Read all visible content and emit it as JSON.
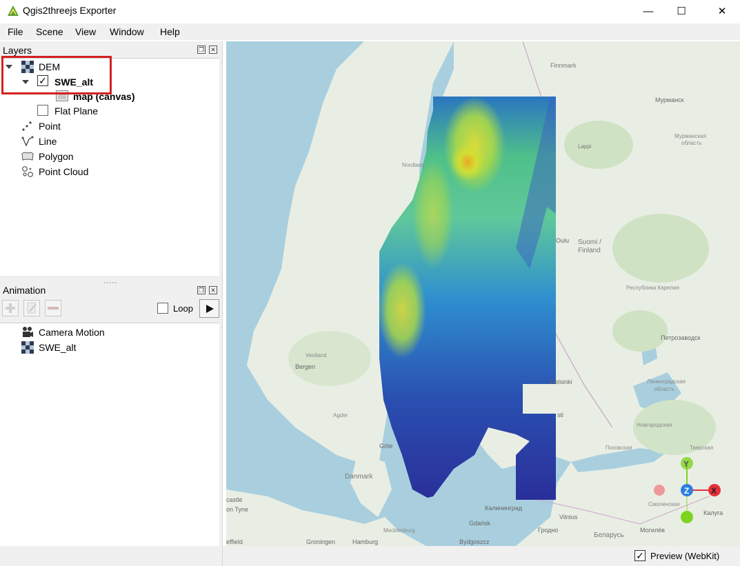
{
  "window": {
    "title": "Qgis2threejs Exporter",
    "minimize_glyph": "—",
    "maximize_glyph": "☐",
    "close_glyph": "✕"
  },
  "menu": [
    "File",
    "Scene",
    "View",
    "Window",
    "Help"
  ],
  "layers_panel": {
    "title": "Layers",
    "items": {
      "dem": "DEM",
      "swe_alt": "SWE_alt",
      "map_canvas": "map (canvas)",
      "flat_plane": "Flat Plane",
      "point": "Point",
      "line": "Line",
      "polygon": "Polygon",
      "point_cloud": "Point Cloud"
    }
  },
  "animation_panel": {
    "title": "Animation",
    "loop_label": "Loop",
    "items": [
      "Camera Motion",
      "SWE_alt"
    ]
  },
  "status": {
    "preview_label": "Preview (WebKit)",
    "preview_checked": true
  },
  "map_labels": {
    "finnmark": "Finnmark",
    "murmansk": "Мурманск",
    "murmansk_obl": "Мурманская",
    "oblast": "область",
    "lappi": "Lappi",
    "nordland": "Nordland",
    "oulu": "Oulu",
    "suomi": "Suomi /",
    "finland": "Finland",
    "karelia": "Республика Карелия",
    "petrozavodsk": "Петрозаводск",
    "leningrad": "Ленинградская",
    "novgorod": "Новгородская",
    "pskov": "Псковская",
    "tver": "Тверская",
    "smolensk": "Смоленская",
    "kaluga": "Калуга",
    "bergen": "Bergen",
    "vestland": "Vestland",
    "agder": "Agder",
    "helsinki": "Helsinki",
    "sti": "sti",
    "danmark": "Danmark",
    "gote": "Göte",
    "castle": "castle",
    "on_tyne": "on Tyne",
    "ffield": "effield",
    "groningen": "Groningen",
    "hamburg": "Hamburg",
    "mecklenburg": "Mecklenburg",
    "gdansk": "Gdańsk",
    "bydgoszcz": "Bydgoszcz",
    "kaliningrad": "Калининград",
    "vilnius": "Vilnius",
    "grodno": "Гродно",
    "belarus": "Беларусь",
    "mogilev": "Могилёв"
  },
  "axes": {
    "x": "X",
    "y": "Y",
    "z": "Z"
  },
  "colors": {
    "selection_border": "#d42020",
    "map_water": "#a9cfdf",
    "land": "#e9eee4",
    "axis_x": "#e8303a",
    "axis_y": "#7ed321",
    "axis_z": "#2f7de1"
  }
}
